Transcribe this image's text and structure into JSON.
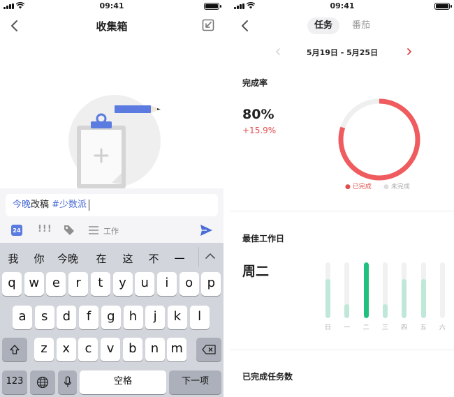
{
  "status_bar": {
    "time": "09:41"
  },
  "left": {
    "nav": {
      "title": "收集箱"
    },
    "input": {
      "parts": [
        "今晚",
        "改稿",
        " #少数派"
      ]
    },
    "toolbar": {
      "date_day": "24",
      "priority_label": "!!!",
      "list_label": "工作"
    },
    "keyboard": {
      "candidates": [
        "我",
        "你",
        "今晚",
        "在",
        "这",
        "不",
        "一"
      ],
      "row1": [
        "q",
        "w",
        "e",
        "r",
        "t",
        "y",
        "u",
        "i",
        "o",
        "p"
      ],
      "row2": [
        "a",
        "s",
        "d",
        "f",
        "g",
        "h",
        "j",
        "k",
        "l"
      ],
      "row3": [
        "z",
        "x",
        "c",
        "v",
        "b",
        "n",
        "m"
      ],
      "num_key": "123",
      "space_key": "空格",
      "return_key": "下一项"
    }
  },
  "right": {
    "tabs": [
      "任务",
      "番茄"
    ],
    "date_range": "5月19日 - 5月25日",
    "completion": {
      "title": "完成率",
      "rate": "80%",
      "change": "+15.9%",
      "completed_fraction": 0.8,
      "legend_done": "已完成",
      "legend_undone": "未完成"
    },
    "best_day": {
      "title": "最佳工作日",
      "value": "周二",
      "days": [
        "日",
        "一",
        "二",
        "三",
        "四",
        "五",
        "六"
      ],
      "fractions": [
        0.7,
        0.25,
        1.0,
        0.25,
        0.7,
        0.7,
        0
      ],
      "highlight_index": 2
    },
    "completed_count": {
      "title": "已完成任务数"
    }
  },
  "colors": {
    "accent_blue": "#4a6bd6",
    "ring_done": "#ef5b5e",
    "ring_track": "#efefef",
    "bar_light": "#bfe8d8",
    "bar_strong": "#22c07f",
    "change_red": "#e24b4b"
  }
}
